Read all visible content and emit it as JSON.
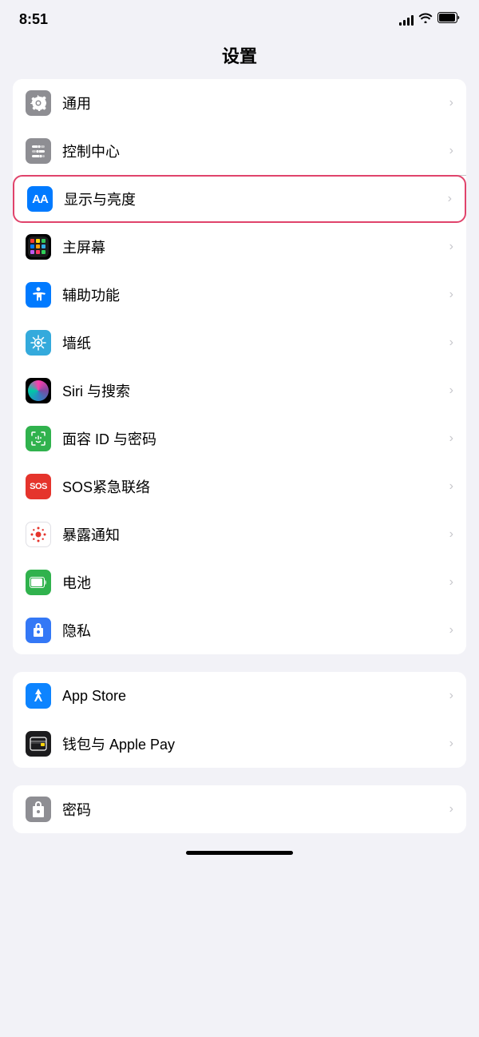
{
  "statusBar": {
    "time": "8:51",
    "signalLabel": "signal",
    "wifiLabel": "wifi",
    "batteryLabel": "battery"
  },
  "pageTitle": "设置",
  "sections": [
    {
      "id": "section1",
      "rows": [
        {
          "id": "general",
          "label": "通用",
          "iconType": "gear",
          "iconBg": "gray",
          "highlighted": false
        },
        {
          "id": "control-center",
          "label": "控制中心",
          "iconType": "toggles",
          "iconBg": "gray",
          "highlighted": false
        },
        {
          "id": "display",
          "label": "显示与亮度",
          "iconType": "aa",
          "iconBg": "blue",
          "highlighted": true
        },
        {
          "id": "homescreen",
          "label": "主屏幕",
          "iconType": "grid",
          "iconBg": "homescreen",
          "highlighted": false
        },
        {
          "id": "accessibility",
          "label": "辅助功能",
          "iconType": "accessibility",
          "iconBg": "blue",
          "highlighted": false
        },
        {
          "id": "wallpaper",
          "label": "墙纸",
          "iconType": "flower",
          "iconBg": "wallpaper",
          "highlighted": false
        },
        {
          "id": "siri",
          "label": "Siri 与搜索",
          "iconType": "siri",
          "iconBg": "black",
          "highlighted": false
        },
        {
          "id": "faceid",
          "label": "面容 ID 与密码",
          "iconType": "faceid",
          "iconBg": "green",
          "highlighted": false
        },
        {
          "id": "sos",
          "label": "SOS紧急联络",
          "iconType": "sos",
          "iconBg": "red",
          "highlighted": false
        },
        {
          "id": "exposure",
          "label": "暴露通知",
          "iconType": "exposure",
          "iconBg": "white",
          "highlighted": false
        },
        {
          "id": "battery",
          "label": "电池",
          "iconType": "battery",
          "iconBg": "green",
          "highlighted": false
        },
        {
          "id": "privacy",
          "label": "隐私",
          "iconType": "hand",
          "iconBg": "blue2",
          "highlighted": false
        }
      ]
    },
    {
      "id": "section2",
      "rows": [
        {
          "id": "appstore",
          "label": "App Store",
          "iconType": "appstore",
          "iconBg": "appstore",
          "highlighted": false
        },
        {
          "id": "wallet",
          "label": "钱包与 Apple Pay",
          "iconType": "wallet",
          "iconBg": "dark",
          "highlighted": false
        }
      ]
    },
    {
      "id": "section3",
      "rows": [
        {
          "id": "passwords",
          "label": "密码",
          "iconType": "passwords",
          "iconBg": "gray2",
          "highlighted": false
        }
      ]
    }
  ]
}
